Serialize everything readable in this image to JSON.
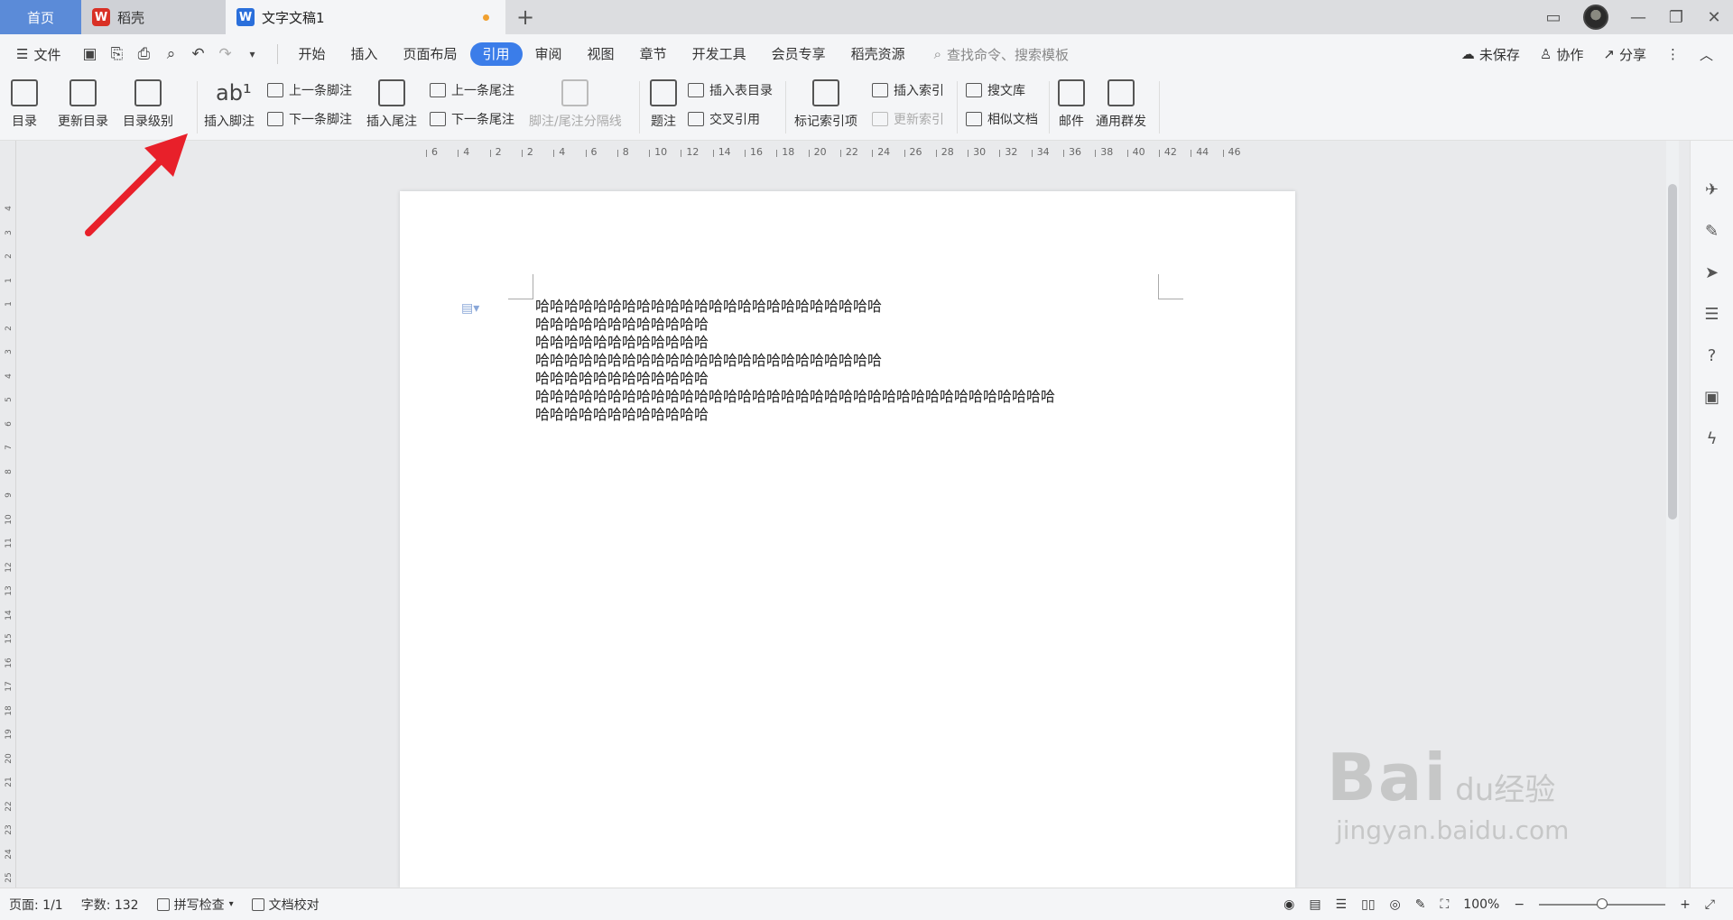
{
  "tabs": {
    "home": "首页",
    "daoke": "稻壳",
    "doc": "文字文稿1",
    "add": "+"
  },
  "menu": {
    "file": "文件",
    "tabs": [
      "开始",
      "插入",
      "页面布局",
      "引用",
      "审阅",
      "视图",
      "章节",
      "开发工具",
      "会员专享",
      "稻壳资源"
    ],
    "active_tab": "引用",
    "search_placeholder": "查找命令、搜索模板",
    "unsaved": "未保存",
    "collab": "协作",
    "share": "分享"
  },
  "ribbon": {
    "toc": "目录",
    "update_toc": "更新目录",
    "toc_level": "目录级别",
    "insert_footnote": "插入脚注",
    "prev_footnote": "上一条脚注",
    "next_footnote": "下一条脚注",
    "insert_endnote": "插入尾注",
    "prev_endnote": "上一条尾注",
    "next_endnote": "下一条尾注",
    "note_separator": "脚注/尾注分隔线",
    "caption": "题注",
    "insert_table_of_figures": "插入表目录",
    "cross_ref": "交叉引用",
    "mark_index": "标记索引项",
    "insert_index": "插入索引",
    "update_index": "更新索引",
    "search_library": "搜文库",
    "similar_docs": "相似文档",
    "mail": "邮件",
    "mass_send": "通用群发"
  },
  "ruler_top": [
    "6",
    "4",
    "2",
    "2",
    "4",
    "6",
    "8",
    "10",
    "12",
    "14",
    "16",
    "18",
    "20",
    "22",
    "24",
    "26",
    "28",
    "30",
    "32",
    "34",
    "36",
    "38",
    "40",
    "42",
    "44",
    "46"
  ],
  "ruler_left": [
    "4",
    "3",
    "2",
    "1",
    "1",
    "2",
    "3",
    "4",
    "5",
    "6",
    "7",
    "8",
    "9",
    "10",
    "11",
    "12",
    "13",
    "14",
    "15",
    "16",
    "17",
    "18",
    "19",
    "20",
    "21",
    "22",
    "23",
    "24",
    "25"
  ],
  "document": {
    "lines": [
      "哈哈哈哈哈哈哈哈哈哈哈哈哈哈哈哈哈哈哈哈哈哈哈哈",
      "哈哈哈哈哈哈哈哈哈哈哈哈",
      "哈哈哈哈哈哈哈哈哈哈哈哈",
      "哈哈哈哈哈哈哈哈哈哈哈哈哈哈哈哈哈哈哈哈哈哈哈哈",
      "哈哈哈哈哈哈哈哈哈哈哈哈",
      "哈哈哈哈哈哈哈哈哈哈哈哈哈哈哈哈哈哈哈哈哈哈哈哈哈哈哈哈哈哈哈哈哈哈哈哈",
      "哈哈哈哈哈哈哈哈哈哈哈哈"
    ]
  },
  "status": {
    "page": "页面: 1/1",
    "words": "字数: 132",
    "spell": "拼写检查",
    "proof": "文档校对",
    "zoom": "100%",
    "zoom_fraction": 0.5
  },
  "watermark": {
    "main": "Bai",
    "sub": "du经验",
    "url": "jingyan.baidu.com"
  },
  "colors": {
    "active_tab": "#3b7de9",
    "home_tab": "#5b8bd8",
    "arrow": "#e8202a"
  }
}
